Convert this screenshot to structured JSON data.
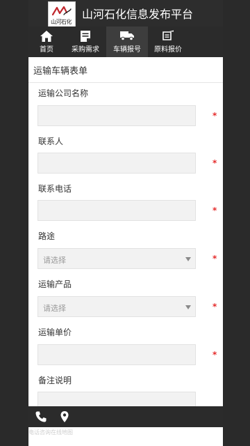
{
  "header": {
    "site_title": "山河石化信息发布平台",
    "logo_text": "山河石化"
  },
  "nav": {
    "items": [
      {
        "label": "首页",
        "icon": "home-icon"
      },
      {
        "label": "采购需求",
        "icon": "document-icon"
      },
      {
        "label": "车辆报号",
        "icon": "truck-icon"
      },
      {
        "label": "原料报价",
        "icon": "pen-paper-icon"
      }
    ],
    "active_index": 2
  },
  "form": {
    "title": "运输车辆表单",
    "required_mark": "*",
    "fields": [
      {
        "label": "运输公司名称",
        "value": ""
      },
      {
        "label": "联系人",
        "value": ""
      },
      {
        "label": "联系电话",
        "value": ""
      },
      {
        "label": "路途",
        "select_text": "请选择"
      },
      {
        "label": "运输产品",
        "select_text": "请选择"
      },
      {
        "label": "运输单价",
        "value": ""
      },
      {
        "label": "备注说明",
        "value": ""
      }
    ]
  },
  "footer": {
    "text": "电话咨询在线地图",
    "icons": [
      "phone-icon",
      "map-pin-icon"
    ]
  },
  "colors": {
    "dark_bg": "#2b2b2b",
    "required": "#e52c2c",
    "field_bg": "#f2f2f2"
  }
}
